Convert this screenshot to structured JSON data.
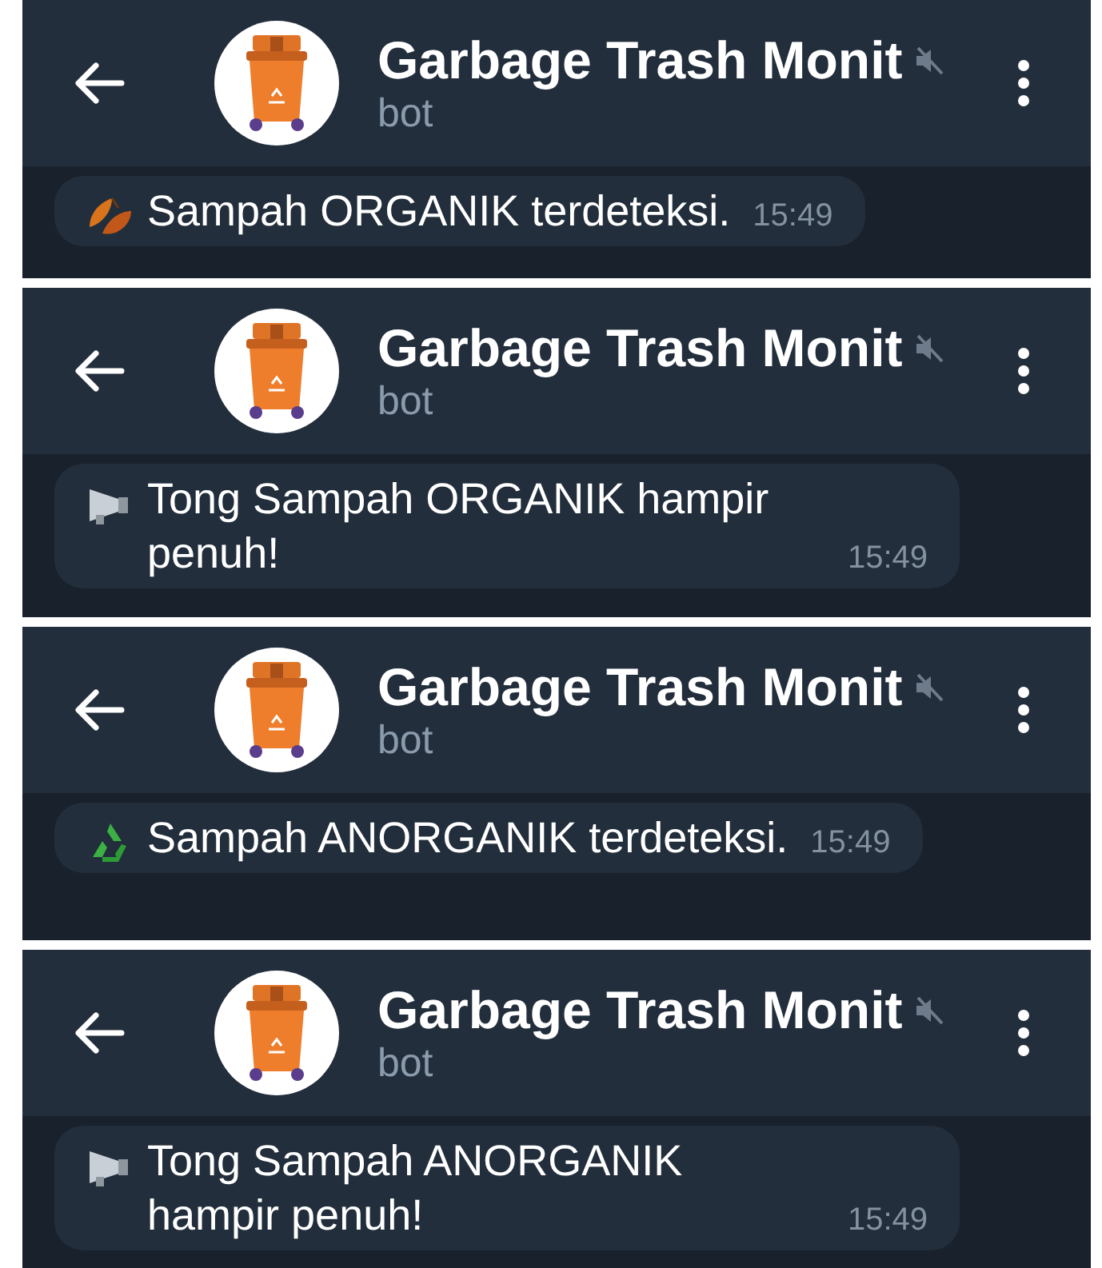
{
  "screens": [
    {
      "header": {
        "title": "Garbage Trash Monit",
        "subtitle": "bot",
        "muted": true
      },
      "message": {
        "kind": "leaves",
        "text": "Sampah ORGANIK terdeteksi.",
        "time": "15:49"
      }
    },
    {
      "header": {
        "title": "Garbage Trash Monit",
        "subtitle": "bot",
        "muted": true
      },
      "message": {
        "kind": "megaphone",
        "text": "Tong Sampah ORGANIK hampir penuh!",
        "time": "15:49"
      }
    },
    {
      "header": {
        "title": "Garbage Trash Monit",
        "subtitle": "bot",
        "muted": true
      },
      "message": {
        "kind": "recycle",
        "text": "Sampah ANORGANIK terdeteksi.",
        "time": "15:49"
      }
    },
    {
      "header": {
        "title": "Garbage Trash Monit",
        "subtitle": "bot",
        "muted": true
      },
      "message": {
        "kind": "megaphone",
        "text": "Tong Sampah ANORGANIK hampir penuh!",
        "time": "15:49"
      }
    }
  ]
}
